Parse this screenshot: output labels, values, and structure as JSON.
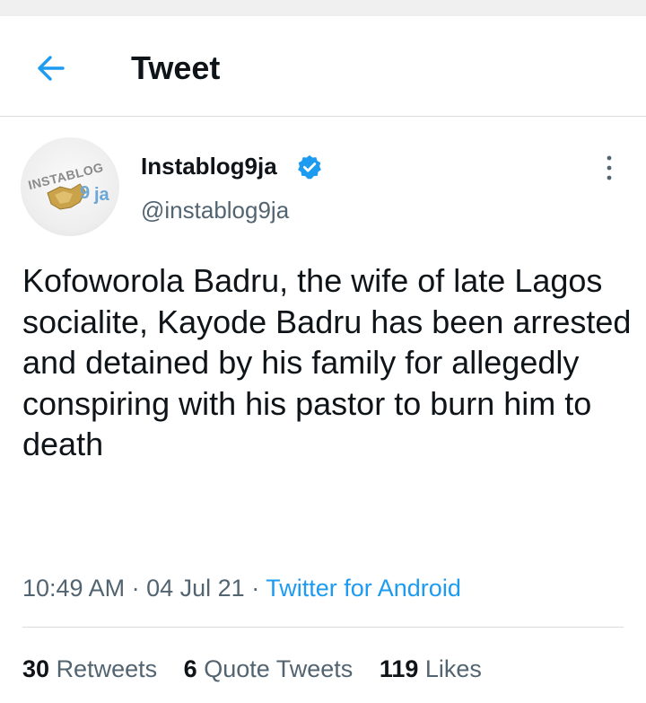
{
  "header": {
    "title": "Tweet"
  },
  "author": {
    "name": "Instablog9ja",
    "handle": "@instablog9ja",
    "verified": true,
    "avatar_logo_text": "INSTABLOG 9ja"
  },
  "tweet": {
    "text": "Kofoworola Badru, the wife of late Lagos socialite, Kayode Badru has been arrested and detained by his family for allegedly conspiring with his pastor to burn him to death",
    "time": "10:49 AM",
    "date": "04 Jul 21",
    "separator": "·",
    "source": "Twitter for Android"
  },
  "stats": {
    "retweets_count": "30",
    "retweets_label": "Retweets",
    "quote_tweets_count": "6",
    "quote_tweets_label": "Quote Tweets",
    "likes_count": "119",
    "likes_label": "Likes"
  },
  "colors": {
    "accent": "#1d9bf0",
    "text_primary": "#0f1419",
    "text_secondary": "#536471",
    "divider": "#d9dde0"
  },
  "icons": {
    "back": "arrow-left-icon",
    "verified": "verified-badge-icon",
    "more": "more-vertical-icon"
  }
}
